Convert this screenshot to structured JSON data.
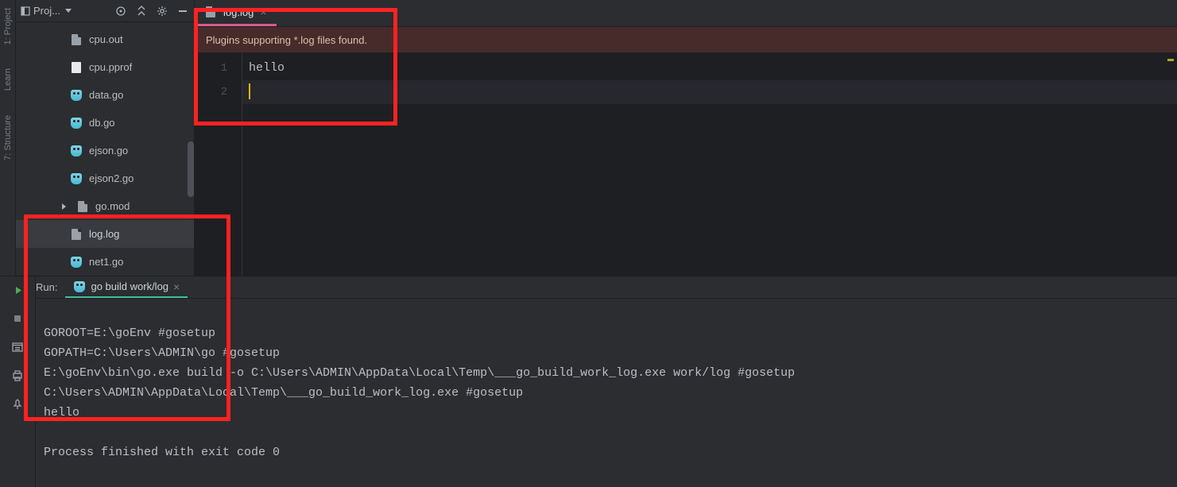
{
  "sidebar": {
    "header_label": "Proj...",
    "files": [
      {
        "name": "cpu.out",
        "icon": "doc"
      },
      {
        "name": "cpu.pprof",
        "icon": "plain"
      },
      {
        "name": "data.go",
        "icon": "go"
      },
      {
        "name": "db.go",
        "icon": "go"
      },
      {
        "name": "ejson.go",
        "icon": "go"
      },
      {
        "name": "ejson2.go",
        "icon": "go"
      },
      {
        "name": "go.mod",
        "icon": "doc",
        "arrowed": true
      },
      {
        "name": "log.log",
        "icon": "doc",
        "selected": true
      },
      {
        "name": "net1.go",
        "icon": "go"
      }
    ]
  },
  "left_rail": {
    "items": [
      "1: Project",
      "Learn",
      "7: Structure"
    ]
  },
  "editor": {
    "tab": {
      "label": "log.log"
    },
    "notification": "Plugins supporting *.log files found.",
    "lines": {
      "1": "hello",
      "2": ""
    },
    "gutter": {
      "1": "1",
      "2": "2"
    }
  },
  "run": {
    "label": "Run:",
    "tab": {
      "label": "go build work/log"
    },
    "console_lines": [
      "GOROOT=E:\\goEnv #gosetup",
      "GOPATH=C:\\Users\\ADMIN\\go #gosetup",
      "E:\\goEnv\\bin\\go.exe build -o C:\\Users\\ADMIN\\AppData\\Local\\Temp\\___go_build_work_log.exe work/log #gosetup",
      "C:\\Users\\ADMIN\\AppData\\Local\\Temp\\___go_build_work_log.exe #gosetup",
      "hello",
      "",
      "Process finished with exit code 0"
    ]
  }
}
